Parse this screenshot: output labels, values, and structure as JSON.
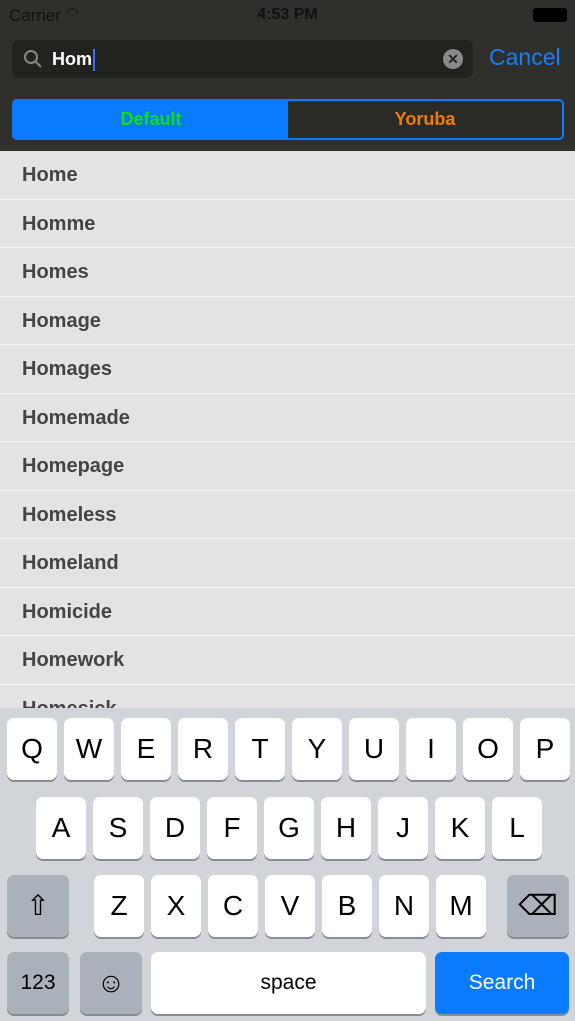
{
  "status": {
    "carrier": "Carrier",
    "time": "4:53 PM"
  },
  "search": {
    "value": "Hom",
    "cancel": "Cancel"
  },
  "segments": {
    "default": "Default",
    "yoruba": "Yoruba",
    "selected": "Default"
  },
  "results": [
    "Home",
    "Homme",
    "Homes",
    "Homage",
    "Homages",
    "Homemade",
    "Homepage",
    "Homeless",
    "Homeland",
    "Homicide",
    "Homework",
    "Homesick"
  ],
  "keyboard": {
    "row1": [
      "Q",
      "W",
      "E",
      "R",
      "T",
      "Y",
      "U",
      "I",
      "O",
      "P"
    ],
    "row2": [
      "A",
      "S",
      "D",
      "F",
      "G",
      "H",
      "J",
      "K",
      "L"
    ],
    "row3": [
      "Z",
      "X",
      "C",
      "V",
      "B",
      "N",
      "M"
    ],
    "numbers": "123",
    "space": "space",
    "search": "Search"
  },
  "colors": {
    "accent": "#0a7bff",
    "default_text": "#11e011",
    "yoruba_text": "#f07c0a"
  }
}
